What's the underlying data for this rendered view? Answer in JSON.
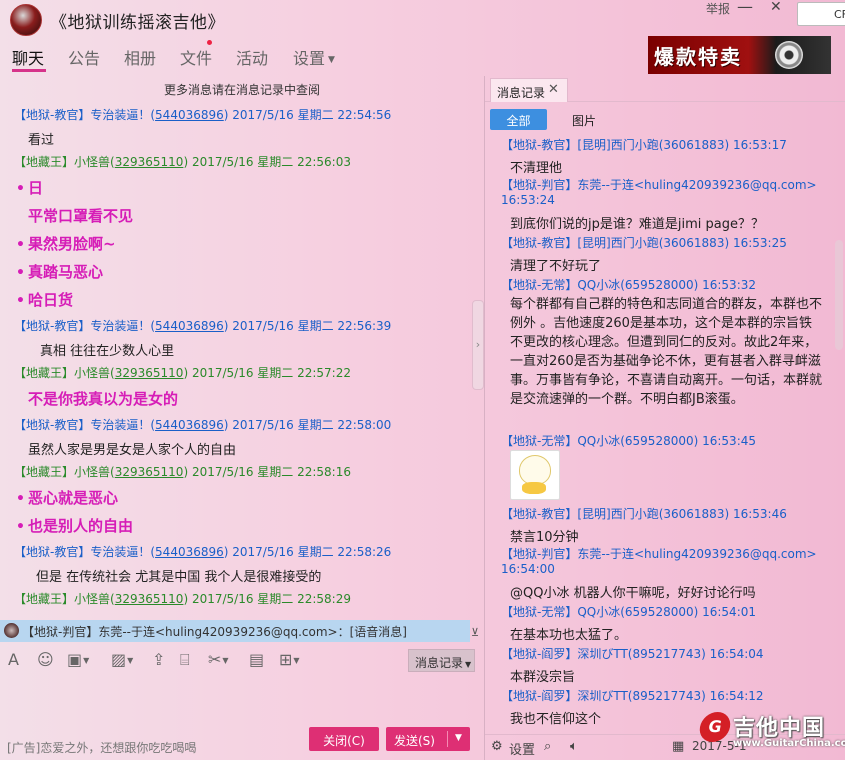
{
  "window": {
    "title": "《地狱训练摇滚吉他》",
    "report_label": "举报",
    "minimize_glyph": "—",
    "close_glyph": "✕",
    "corner_button": "CF"
  },
  "nav_tabs": [
    "聊天",
    "公告",
    "相册",
    "文件",
    "活动",
    "设置"
  ],
  "ad_banner": {
    "text": "爆款特卖"
  },
  "chat": {
    "more_messages": "更多消息请在消息记录中查阅",
    "messages": [
      {
        "role": "【地狱-教官】",
        "name": "专治装逼！",
        "qq": "544036896",
        "time": "2017/5/16 星期二 22:54:56"
      },
      {
        "text": "看过"
      },
      {
        "role": "【地藏王】",
        "name": "小怪兽",
        "qq": "329365110",
        "time": "2017/5/16 星期二 22:56:03"
      },
      {
        "big": "日"
      },
      {
        "big": "平常口罩看不见"
      },
      {
        "big": "果然男脸啊~"
      },
      {
        "big": "真踏马恶心"
      },
      {
        "big": "哈日货"
      },
      {
        "role": "【地狱-教官】",
        "name": "专治装逼！",
        "qq": "544036896",
        "time": "2017/5/16 星期二 22:56:39"
      },
      {
        "text": "真相  往往在少数人心里"
      },
      {
        "role": "【地藏王】",
        "name": "小怪兽",
        "qq": "329365110",
        "time": "2017/5/16 星期二 22:57:22"
      },
      {
        "big": "不是你我真以为是女的"
      },
      {
        "role": "【地狱-教官】",
        "name": "专治装逼！",
        "qq": "544036896",
        "time": "2017/5/16 星期二 22:58:00"
      },
      {
        "text": "虽然人家是男是女是人家个人的自由"
      },
      {
        "role": "【地藏王】",
        "name": "小怪兽",
        "qq": "329365110",
        "time": "2017/5/16 星期二 22:58:16"
      },
      {
        "big": "恶心就是恶心"
      },
      {
        "big": "也是别人的自由"
      },
      {
        "role": "【地狱-教官】",
        "name": "专治装逼！",
        "qq": "544036896",
        "time": "2017/5/16 星期二 22:58:26"
      },
      {
        "text": "但是   在传统社会  尤其是中国   我个人是很难接受的"
      },
      {
        "role": "【地藏王】",
        "name": "小怪兽",
        "qq": "329365110",
        "time": "2017/5/16 星期二 22:58:29"
      }
    ],
    "voice_bar": "【地狱-判官】东莞--于连<huling420939236@qq.com>：[语音消息]",
    "history_button": "消息记录",
    "ad_text": "[广告]恋爱之外，还想跟你吃吃喝喝",
    "close_button": "关闭(C)",
    "send_button": "发送(S)"
  },
  "record_panel": {
    "tab_label": "消息记录",
    "filter_all": "全部",
    "filter_images": "图片",
    "entries": [
      {
        "head": "【地狱-教官】[昆明]西门小跑(36061883) 16:53:17",
        "body": "不清理他"
      },
      {
        "head": "【地狱-判官】东莞--于连<huling420939236@qq.com> 16:53:24",
        "body": "到底你们说的jp是谁？难道是jimi page？？"
      },
      {
        "head": "【地狱-教官】[昆明]西门小跑(36061883) 16:53:25",
        "body": "清理了不好玩了"
      },
      {
        "head": "【地狱-无常】QQ小冰(659528000) 16:53:32",
        "body": "每个群都有自己群的特色和志同道合的群友，本群也不例外 。吉他速度260是基本功，这个是本群的宗旨铁不更改的核心理念。但遭到同仁的反对。故此2年来，一直对260是否为基础争论不休，更有甚者入群寻衅滋事。万事皆有争论，不喜请自动离开。一句话，本群就是交流速弹的一个群。不明白都JB滚蛋。"
      },
      {
        "head": "【地狱-无常】QQ小冰(659528000) 16:53:45",
        "body": ""
      },
      {
        "head": "【地狱-教官】[昆明]西门小跑(36061883) 16:53:46",
        "body": "禁言10分钟"
      },
      {
        "head": "【地狱-判官】东莞--于连<huling420939236@qq.com> 16:54:00",
        "body": "@QQ小冰 机器人你干嘛呢，好好讨论行吗"
      },
      {
        "head": "【地狱-无常】QQ小冰(659528000) 16:54:01",
        "body": "在基本功也太猛了。"
      },
      {
        "head": "【地狱-阎罗】深圳びTT(895217743) 16:54:04",
        "body": "本群没宗旨"
      },
      {
        "head": "【地狱-阎罗】深圳びTT(895217743) 16:54:12",
        "body": "我也不信仰这个"
      }
    ],
    "bottom": {
      "settings_label": "设置",
      "date_partial": "2017-5-1"
    }
  },
  "watermark": {
    "cn": "吉他中国",
    "en": "www.GuitarChina.com",
    "badge": "G"
  },
  "colors": {
    "accent": "#d6338a",
    "big_text": "#d61db7",
    "link_blue": "#1a5fc8",
    "green": "#2a8a2a",
    "button": "#de2f74",
    "filter_active": "#3d8fe0"
  }
}
